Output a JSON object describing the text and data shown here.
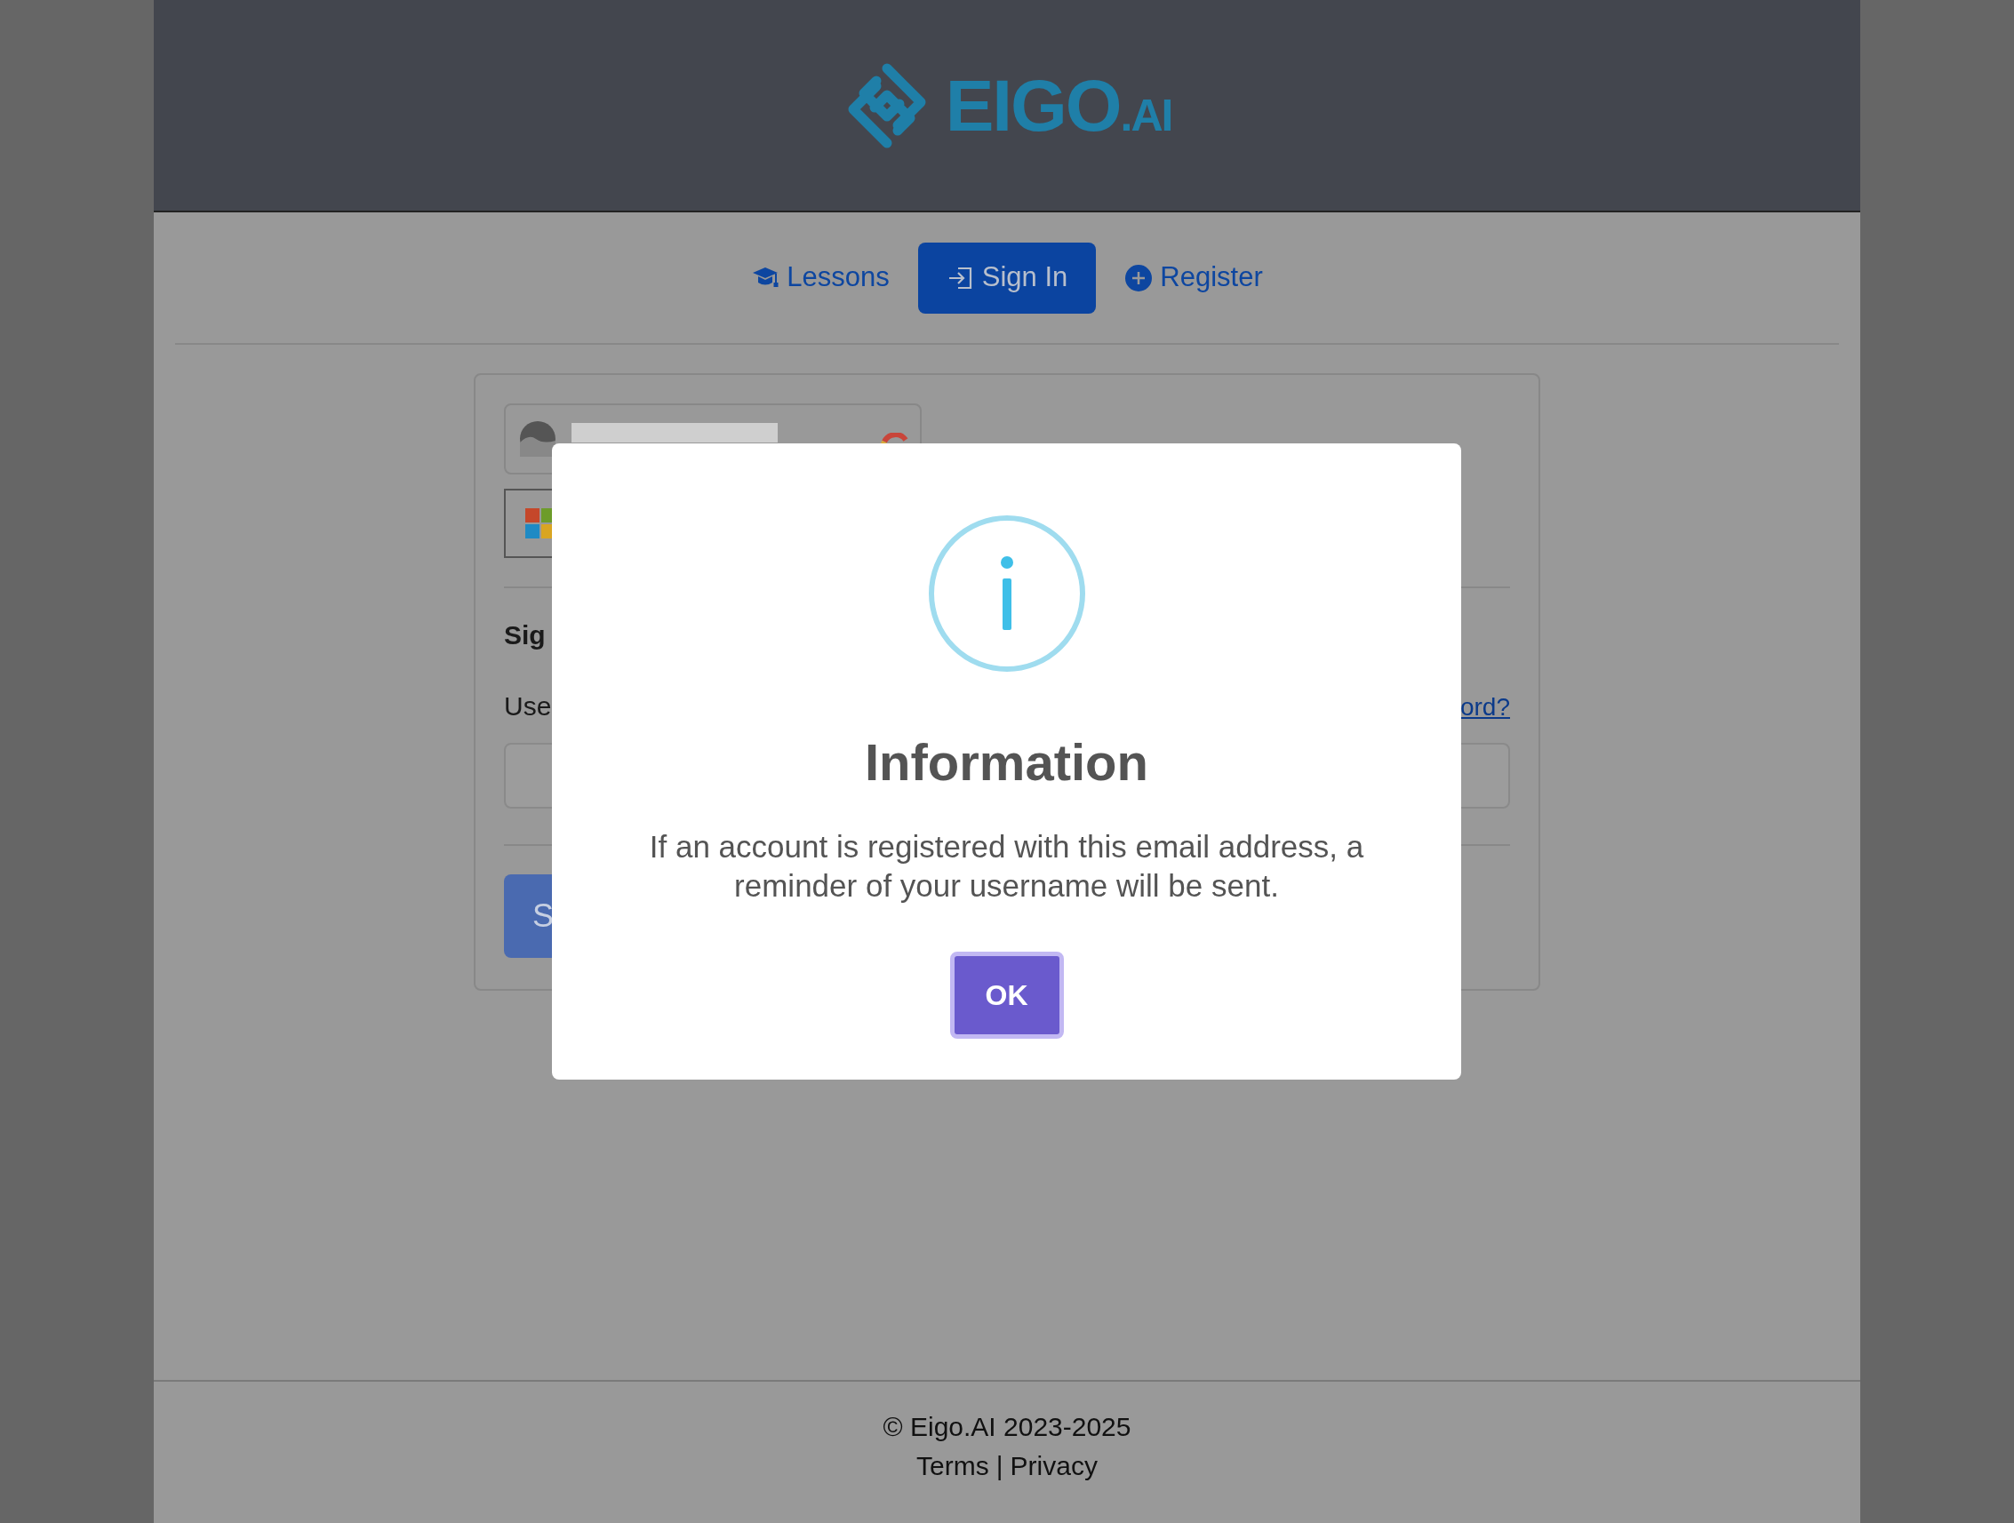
{
  "header": {
    "logo": {
      "name": "EIGO",
      "suffix": ".AI"
    }
  },
  "nav": [
    {
      "label": "Lessons",
      "selected": false
    },
    {
      "label": "Sign In",
      "selected": true
    },
    {
      "label": "Register",
      "selected": false
    }
  ],
  "login_card": {
    "heading": "Sig",
    "username_label": "Use",
    "forgot_link": "ord?",
    "submit_button": "S"
  },
  "dialog": {
    "title": "Information",
    "message_lines": [
      "If an account is registered with this email address, a",
      "reminder of your username will be sent."
    ],
    "button": "OK"
  },
  "footer": {
    "copyright": "© Eigo.AI 2023-2025",
    "links": [
      "Terms",
      "Privacy"
    ],
    "separator": "|"
  }
}
